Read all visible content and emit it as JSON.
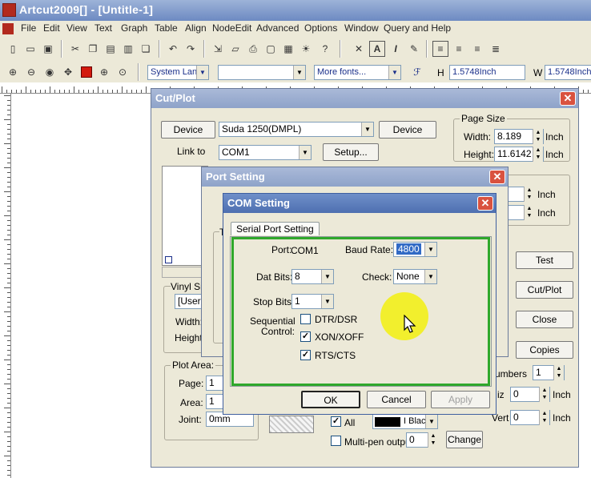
{
  "window": {
    "title": "Artcut2009[] - [Untitle-1]"
  },
  "menu": [
    "File",
    "Edit",
    "View",
    "Text",
    "Graph",
    "Table",
    "Align",
    "NodeEdit",
    "Advanced",
    "Options",
    "Window",
    "Query and Help"
  ],
  "toolbar2": {
    "font_lang": "System Lan",
    "font_name": "",
    "more_fonts": "More fonts...",
    "h_label": "H",
    "h_value": "1.5748Inch",
    "w_label": "W",
    "w_value": "1.5748Inch"
  },
  "cutplot": {
    "title": "Cut/Plot",
    "device_btn1": "Device",
    "device_value": "Suda 1250(DMPL)",
    "device_btn2": "Device",
    "link_label": "Link to",
    "link_value": "COM1",
    "setup_btn": "Setup...",
    "page_size": {
      "legend": "Page Size",
      "width_label": "Width:",
      "width_value": "8.189",
      "height_label": "Height:",
      "height_value": "11.6142",
      "unit": "Inch"
    },
    "extra_unit1": "Inch",
    "extra_unit2": "Inch",
    "test_btn": "Test",
    "cutplot_btn": "Cut/Plot",
    "close_btn": "Close",
    "copies_btn": "Copies",
    "numbers_label": "umbers",
    "numbers_value": "1",
    "horiz_label": "iz",
    "horiz_value": "0",
    "horiz_unit": "Inch",
    "vert_label": "Vert",
    "vert_value": "0",
    "vert_unit": "Inch",
    "vinyl_label": "Vinyl Siz",
    "vinyl_value": "[User",
    "vinyl_width": "Width:",
    "vinyl_height": "Height:",
    "plot_area": {
      "legend": "Plot Area:",
      "page_label": "Page:",
      "page_value": "1",
      "area_label": "Area:",
      "area_value": "1",
      "joint_label": "Joint:",
      "joint_value": "0mm"
    },
    "all_label": "All",
    "color_value": "I Blac",
    "multipen_label": "Multi-pen output",
    "multipen_value": "0",
    "change_btn": "Change"
  },
  "port_setting": {
    "title": "Port Setting",
    "group_letter": "T"
  },
  "com_setting": {
    "title": "COM Setting",
    "tab": "Serial Port Setting",
    "port_label": "Port:",
    "port_value": "COM1",
    "baud_label": "Baud Rate:",
    "baud_value": "4800",
    "databits_label": "Dat Bits:",
    "databits_value": "8",
    "check_label": "Check:",
    "check_value": "None",
    "stopbits_label": "Stop Bits:",
    "stopbits_value": "1",
    "seq_label_1": "Sequential",
    "seq_label_2": "Control:",
    "dtr_label": "DTR/DSR",
    "dtr_checked": false,
    "xon_label": "XON/XOFF",
    "xon_checked": true,
    "rts_label": "RTS/CTS",
    "rts_checked": true,
    "ok_btn": "OK",
    "cancel_btn": "Cancel",
    "apply_btn": "Apply"
  },
  "colors": {
    "green_frame": "#2fa82b",
    "highlight": "#f2ef1e",
    "title_active": "#4e6fb0"
  }
}
